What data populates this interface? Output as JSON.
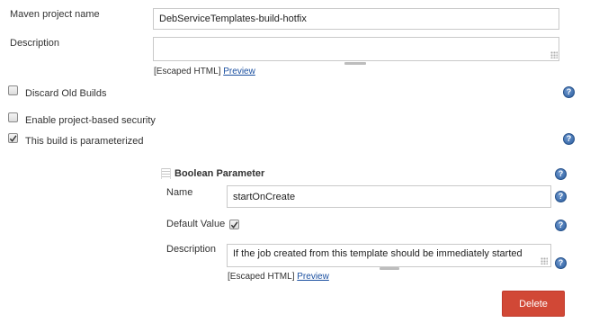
{
  "project": {
    "name_label": "Maven project name",
    "name_value": "DebServiceTemplates-build-hotfix",
    "description_label": "Description",
    "description_value": "",
    "escaped_html": "[Escaped HTML]",
    "preview": "Preview"
  },
  "options": {
    "discard_old_builds": {
      "label": "Discard Old Builds",
      "checked": false
    },
    "project_security": {
      "label": "Enable project-based security",
      "checked": false
    },
    "parameterized": {
      "label": "This build is parameterized",
      "checked": true
    }
  },
  "parameter": {
    "title": "Boolean Parameter",
    "name_label": "Name",
    "name_value": "startOnCreate",
    "default_label": "Default Value",
    "default_checked": true,
    "description_label": "Description",
    "description_value": "If the job created from this template should be immediately started",
    "escaped_html": "[Escaped HTML]",
    "preview": "Preview",
    "delete_label": "Delete"
  },
  "help_glyph": "?",
  "icons": [
    "help-icon",
    "checkbox-checked-icon",
    "drag-handle-icon",
    "resize-grip-icon"
  ]
}
